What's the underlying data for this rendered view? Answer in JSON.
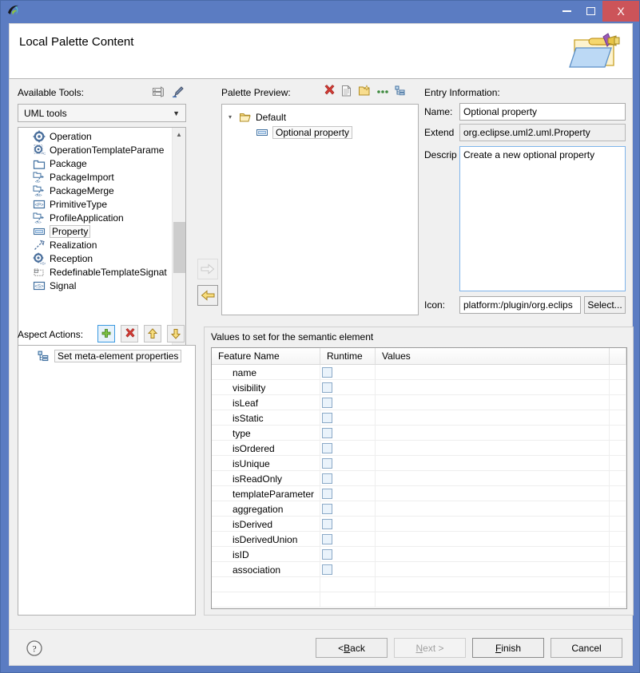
{
  "window": {
    "app_icon": "eclipse-papyrus-icon",
    "minimize_label": "Minimize",
    "maximize_label": "Maximize",
    "close_label": "X"
  },
  "banner": {
    "title": "Local Palette Content",
    "icon": "palette-folder-icon"
  },
  "available_tools": {
    "label": "Available Tools:",
    "icons": [
      {
        "name": "stack-icon",
        "title": "Stack"
      },
      {
        "name": "brush-icon",
        "title": "Brush"
      }
    ],
    "combo": {
      "value": "UML tools",
      "arrow": "chevron-down-icon"
    },
    "items": [
      {
        "label": "Operation",
        "icon": "operation-icon",
        "selected": false
      },
      {
        "label": "OperationTemplateParame",
        "icon": "operation-template-parameter-icon",
        "selected": false
      },
      {
        "label": "Package",
        "icon": "package-icon",
        "selected": false
      },
      {
        "label": "PackageImport",
        "icon": "package-import-icon",
        "selected": false
      },
      {
        "label": "PackageMerge",
        "icon": "package-merge-icon",
        "selected": false
      },
      {
        "label": "PrimitiveType",
        "icon": "primitive-type-icon",
        "selected": false
      },
      {
        "label": "ProfileApplication",
        "icon": "profile-application-icon",
        "selected": false
      },
      {
        "label": "Property",
        "icon": "property-icon",
        "selected": true
      },
      {
        "label": "Realization",
        "icon": "realization-icon",
        "selected": false
      },
      {
        "label": "Reception",
        "icon": "reception-icon",
        "selected": false
      },
      {
        "label": "RedefinableTemplateSignat",
        "icon": "redefinable-template-signature-icon",
        "selected": false
      },
      {
        "label": "Signal",
        "icon": "signal-icon",
        "selected": false
      }
    ]
  },
  "transfer": {
    "add_label": "add-to-palette-arrow",
    "remove_label": "remove-from-palette-arrow"
  },
  "palette_preview": {
    "label": "Palette Preview:",
    "icons": [
      {
        "name": "delete-red-x-icon"
      },
      {
        "name": "new-document-icon"
      },
      {
        "name": "new-folder-icon"
      },
      {
        "name": "more-dots-icon"
      },
      {
        "name": "tree-layout-icon"
      }
    ],
    "tree": {
      "root": {
        "label": "Default",
        "icon": "open-folder-icon",
        "expander": "triangle-expanded-icon"
      },
      "children": [
        {
          "label": "Optional property",
          "icon": "property-icon",
          "selected": true
        }
      ]
    }
  },
  "entry_information": {
    "label": "Entry Information:",
    "name_label": "Name:",
    "name_value": "Optional property",
    "extends_label": "Extend",
    "extends_value": "org.eclipse.uml2.uml.Property",
    "description_label": "Descrip",
    "description_value": "Create a new optional property",
    "icon_label": "Icon:",
    "icon_value": "platform:/plugin/org.eclips",
    "select_button": "Select..."
  },
  "aspect_actions": {
    "label": "Aspect Actions:",
    "buttons": [
      {
        "name": "add-action-button",
        "icon": "green-plus-icon",
        "focused": true
      },
      {
        "name": "delete-action-button",
        "icon": "delete-red-x-icon",
        "focused": false
      },
      {
        "name": "move-up-button",
        "icon": "arrow-up-icon",
        "focused": false
      },
      {
        "name": "move-down-button",
        "icon": "arrow-down-icon",
        "focused": false
      }
    ],
    "items": [
      {
        "label": "Set meta-element properties",
        "icon": "tree-layout-icon",
        "selected": true
      }
    ]
  },
  "values_group": {
    "title": "Values to set for the semantic element",
    "columns": [
      "Feature Name",
      "Runtime",
      "Values"
    ],
    "rows": [
      {
        "feature": "name",
        "runtime": false,
        "value": ""
      },
      {
        "feature": "visibility",
        "runtime": false,
        "value": ""
      },
      {
        "feature": "isLeaf",
        "runtime": false,
        "value": ""
      },
      {
        "feature": "isStatic",
        "runtime": false,
        "value": ""
      },
      {
        "feature": "type",
        "runtime": false,
        "value": ""
      },
      {
        "feature": "isOrdered",
        "runtime": false,
        "value": ""
      },
      {
        "feature": "isUnique",
        "runtime": false,
        "value": ""
      },
      {
        "feature": "isReadOnly",
        "runtime": false,
        "value": ""
      },
      {
        "feature": "templateParameter",
        "runtime": false,
        "value": ""
      },
      {
        "feature": "aggregation",
        "runtime": false,
        "value": ""
      },
      {
        "feature": "isDerived",
        "runtime": false,
        "value": ""
      },
      {
        "feature": "isDerivedUnion",
        "runtime": false,
        "value": ""
      },
      {
        "feature": "isID",
        "runtime": false,
        "value": ""
      },
      {
        "feature": "association",
        "runtime": false,
        "value": ""
      }
    ]
  },
  "footer": {
    "help_icon": "help-question-icon",
    "buttons": [
      {
        "name": "back-button",
        "label": "< Back",
        "mnemonic": "B",
        "enabled": true,
        "default": false
      },
      {
        "name": "next-button",
        "label": "Next >",
        "mnemonic": "N",
        "enabled": false,
        "default": false
      },
      {
        "name": "finish-button",
        "label": "Finish",
        "mnemonic": "F",
        "enabled": true,
        "default": true
      },
      {
        "name": "cancel-button",
        "label": "Cancel",
        "mnemonic": "",
        "enabled": true,
        "default": false
      }
    ]
  },
  "colors": {
    "title_bar": "#5b7cc2",
    "close_button": "#cc5459",
    "panel_bg": "#f0f0f0",
    "field_bg": "#ffffff",
    "accent_focus": "#3b99e0"
  }
}
